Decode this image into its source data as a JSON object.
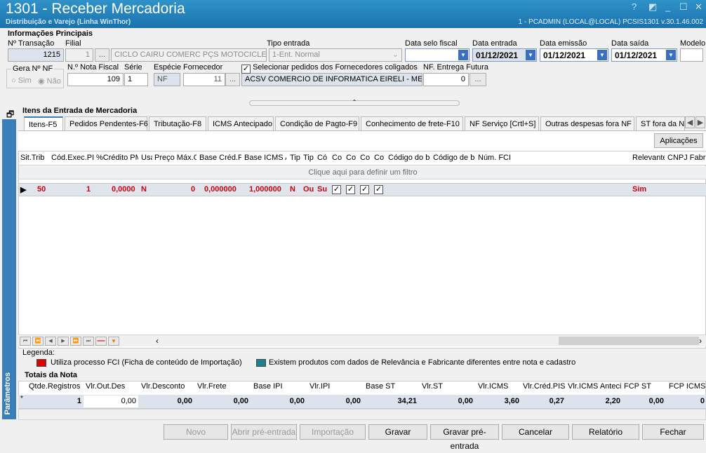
{
  "window": {
    "title": "1301 - Receber Mercadoria",
    "subtitle": "Distribuição e Varejo (Linha WinThor)",
    "status": "1 - PCADMIN (LOCAL@LOCAL)   PCSIS1301  v.30.1.46.002",
    "help": "?",
    "minimize": "_",
    "maximize": "☐",
    "close": "✕"
  },
  "info": {
    "section": "Informações Principais",
    "transacao_label": "Nº Transação",
    "transacao": "1215",
    "filial_label": "Filial",
    "filial": "1",
    "cliente": "CICLO CAIRU COMERC PÇS MOTOCICLETAS LTDA",
    "tipo_label": "Tipo entrada",
    "tipo": "1-Ent. Normal",
    "selo_label": "Data selo fiscal",
    "dataentrada_label": "Data entrada",
    "dataentrada": "01/12/2021",
    "dataemissao_label": "Data emissão",
    "dataemissao": "01/12/2021",
    "datasaida_label": "Data saída",
    "datasaida": "01/12/2021",
    "modelo_label": "Modelo",
    "gera_label": "Gera Nº NF",
    "sim": "Sim",
    "nao": "Não",
    "notafiscal_label": "N.º Nota Fiscal",
    "notafiscal": "109",
    "serie_label": "Série",
    "serie": "1",
    "especie_label": "Espécie",
    "especie": "NF",
    "fornecedor_label": "Fornecedor",
    "fornecedor": "11",
    "fornecedor_nome": "ACSV COMERCIO DE INFORMATICA EIRELI - ME",
    "selecionar": "Selecionar pedidos dos Fornecedores coligados",
    "futura_label": "NF. Entrega Futura",
    "futura": "0",
    "dots": "..."
  },
  "items": {
    "section": "Itens da Entrada de Mercadoria",
    "tabs": [
      "Itens-F5",
      "Pedidos Pendentes-F6",
      "Tributação-F8",
      "ICMS Antecipado",
      "Condição de Pagto-F9",
      "Conhecimento de frete-F10",
      "NF Serviço [Crtl+S]",
      "Outras despesas fora NF",
      "ST fora da N"
    ],
    "aplicacoes": "Aplicações",
    "columns": [
      "Sit.Trib",
      "Cód.Exec.PI",
      "%Crédito PM",
      "Usa",
      "Preço Máx.C",
      "Base Créd.P",
      "Base ICMS A",
      "Tip",
      "Tip",
      "Có",
      "Co",
      "Co",
      "Co",
      "Co",
      "Código do be",
      "Código de be",
      "Núm. FCI",
      "Relevante",
      "CNPJ Fabric"
    ],
    "filter": "Clique aqui para definir um filtro",
    "row": {
      "c0": "50",
      "c1": "1",
      "c2": "0,0000",
      "c3": "N",
      "c4": "0",
      "c5": "0,000000",
      "c6": "1,000000",
      "c7": "N",
      "c8": "Ou",
      "c9": "Su",
      "relevante": "Sim"
    }
  },
  "legend": {
    "title": "Legenda:",
    "fci": "Utiliza processo FCI (Ficha de conteúdo de Importação)",
    "relev": "Existem produtos com dados de Relevância e Fabricante diferentes entre nota e cadastro",
    "fci_color": "#e00000",
    "relev_color": "#1f7f8f"
  },
  "totais": {
    "title": "Totais da Nota",
    "headers": [
      "Qtde.Registros",
      "Vlr.Out.Des",
      "Vlr.Desconto",
      "Vlr.Frete",
      "Base IPI",
      "Vlr.IPI",
      "Base ST",
      "Vlr.ST",
      "Vlr.ICMS",
      "Vlr.Créd.PIS",
      "Vlr.ICMS Anteci",
      "FCP ST",
      "FCP ICMS"
    ],
    "values": [
      "1",
      "0,00",
      "0,00",
      "0,00",
      "0,00",
      "0,00",
      "34,21",
      "0,00",
      "3,60",
      "0,27",
      "2,20",
      "0,00",
      "0"
    ]
  },
  "sidebar": "Parâmetros",
  "buttons": [
    "Novo",
    "Abrir pré-entrada",
    "Importação",
    "Gravar",
    "Gravar pré-entrada",
    "Cancelar",
    "Relatório",
    "Fechar"
  ]
}
